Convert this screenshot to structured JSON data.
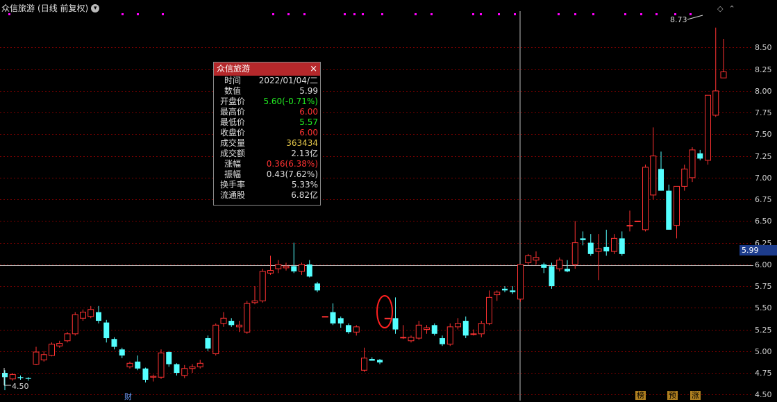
{
  "title": {
    "stock_name": "众信旅游",
    "mode": "(日线 前复权)"
  },
  "colors": {
    "up": "#ff3232",
    "down": "#54ffff",
    "magenta": "#ff00ff",
    "grid": "#7a0000",
    "crosshair": "#c0c0c0"
  },
  "icons": {
    "dropdown": "chevron-down-icon",
    "diamond": "diamond-icon",
    "collapse": "collapse-icon"
  },
  "tooltip": {
    "name": "众信旅游",
    "close_icon": "×",
    "rows": [
      {
        "k": "时间",
        "v": "2022/01/04/二",
        "color": "#dddddd"
      },
      {
        "k": "数值",
        "v": "5.99",
        "color": "#dddddd"
      },
      {
        "k": "开盘价",
        "v": "5.60(-0.71%)",
        "color": "#22ee22"
      },
      {
        "k": "最高价",
        "v": "6.00",
        "color": "#ff3232"
      },
      {
        "k": "最低价",
        "v": "5.57",
        "color": "#22ee22"
      },
      {
        "k": "收盘价",
        "v": "6.00",
        "color": "#ff3232"
      },
      {
        "k": "成交量",
        "v": "363434",
        "color": "#e6c84a"
      },
      {
        "k": "成交额",
        "v": "2.13亿",
        "color": "#dddddd"
      },
      {
        "k": "涨幅",
        "v": "0.36(6.38%)",
        "color": "#ff3232"
      },
      {
        "k": "振幅",
        "v": "0.43(7.62%)",
        "color": "#dddddd"
      },
      {
        "k": "换手率",
        "v": "5.33%",
        "color": "#dddddd"
      },
      {
        "k": "流通股",
        "v": "6.82亿",
        "color": "#dddddd"
      }
    ]
  },
  "current_price_badge": "5.99",
  "high_label": "8.73",
  "low_label": "4.50",
  "markers": [
    {
      "text": "财",
      "kind": "fin"
    },
    {
      "text": "榜",
      "kind": "event"
    },
    {
      "text": "预",
      "kind": "event"
    },
    {
      "text": "涨",
      "kind": "event"
    }
  ],
  "chart_data": {
    "type": "candlestick",
    "yticks": [
      4.5,
      4.75,
      5.0,
      5.25,
      5.5,
      5.75,
      6.0,
      6.25,
      6.5,
      6.75,
      7.0,
      7.25,
      7.5,
      7.75,
      8.0,
      8.25,
      8.5
    ],
    "ytick_labels": [
      "4.50",
      "4.75",
      "5.00",
      "5.25",
      "5.50",
      "5.75",
      "6.00",
      "6.25",
      "6.50",
      "6.75",
      "7.00",
      "7.25",
      "7.50",
      "7.75",
      "8.00",
      "8.25",
      "8.50"
    ],
    "ylim": [
      4.43,
      8.92
    ],
    "current_price": 5.99,
    "candles": [
      [
        4.75,
        4.78,
        4.55,
        4.7
      ],
      [
        4.68,
        4.75,
        4.66,
        4.73
      ],
      [
        4.7,
        4.72,
        4.67,
        4.69
      ],
      [
        4.69,
        4.7,
        4.66,
        4.68
      ],
      [
        4.85,
        5.05,
        4.84,
        4.99
      ],
      [
        4.9,
        5.0,
        4.88,
        4.96
      ],
      [
        4.95,
        5.1,
        4.94,
        5.08
      ],
      [
        5.06,
        5.12,
        5.04,
        5.09
      ],
      [
        5.12,
        5.22,
        5.1,
        5.2
      ],
      [
        5.2,
        5.45,
        5.18,
        5.42
      ],
      [
        5.38,
        5.48,
        5.35,
        5.45
      ],
      [
        5.4,
        5.52,
        5.38,
        5.48
      ],
      [
        5.45,
        5.52,
        5.32,
        5.35
      ],
      [
        5.33,
        5.36,
        5.1,
        5.15
      ],
      [
        5.14,
        5.16,
        5.02,
        5.05
      ],
      [
        5.02,
        5.04,
        4.92,
        4.95
      ],
      [
        4.82,
        4.88,
        4.8,
        4.86
      ],
      [
        4.88,
        4.95,
        4.78,
        4.8
      ],
      [
        4.8,
        4.81,
        4.64,
        4.67
      ],
      [
        4.7,
        4.73,
        4.65,
        4.71
      ],
      [
        4.7,
        5.02,
        4.68,
        4.98
      ],
      [
        4.99,
        5.0,
        4.82,
        4.85
      ],
      [
        4.85,
        4.86,
        4.72,
        4.75
      ],
      [
        4.72,
        4.84,
        4.69,
        4.8
      ],
      [
        4.8,
        4.85,
        4.75,
        4.82
      ],
      [
        4.82,
        4.9,
        4.8,
        4.86
      ],
      [
        5.15,
        5.18,
        5.0,
        5.03
      ],
      [
        4.97,
        5.32,
        4.95,
        5.3
      ],
      [
        5.32,
        5.45,
        5.28,
        5.38
      ],
      [
        5.35,
        5.38,
        5.28,
        5.3
      ],
      [
        5.28,
        5.35,
        5.22,
        5.3
      ],
      [
        5.22,
        5.58,
        5.2,
        5.55
      ],
      [
        5.56,
        5.75,
        5.54,
        5.58
      ],
      [
        5.58,
        5.95,
        5.56,
        5.92
      ],
      [
        5.9,
        6.1,
        5.88,
        5.93
      ],
      [
        5.95,
        6.05,
        5.9,
        6.0
      ],
      [
        5.96,
        6.02,
        5.93,
        5.98
      ],
      [
        5.98,
        6.25,
        5.9,
        5.92
      ],
      [
        5.92,
        6.02,
        5.88,
        6.0
      ],
      [
        6.0,
        6.05,
        5.85,
        5.86
      ],
      [
        5.78,
        5.8,
        5.68,
        5.7
      ],
      [
        5.4,
        5.4,
        5.4,
        5.4
      ],
      [
        5.45,
        5.55,
        5.3,
        5.32
      ],
      [
        5.38,
        5.4,
        5.27,
        5.32
      ],
      [
        5.3,
        5.32,
        5.2,
        5.22
      ],
      [
        5.22,
        5.3,
        5.18,
        5.28
      ],
      [
        4.78,
        5.04,
        4.76,
        4.92
      ],
      [
        4.91,
        4.93,
        4.89,
        4.89
      ],
      [
        4.9,
        4.91,
        4.85,
        4.87
      ],
      [
        5.38,
        5.38,
        5.38,
        5.38
      ],
      [
        5.38,
        5.62,
        5.2,
        5.25
      ],
      [
        5.16,
        5.3,
        5.14,
        5.16
      ],
      [
        5.12,
        5.18,
        5.1,
        5.16
      ],
      [
        5.15,
        5.35,
        5.13,
        5.3
      ],
      [
        5.25,
        5.3,
        5.2,
        5.27
      ],
      [
        5.3,
        5.32,
        5.18,
        5.2
      ],
      [
        5.15,
        5.18,
        5.06,
        5.08
      ],
      [
        5.08,
        5.32,
        5.06,
        5.28
      ],
      [
        5.28,
        5.38,
        5.25,
        5.32
      ],
      [
        5.35,
        5.4,
        5.15,
        5.18
      ],
      [
        5.2,
        5.25,
        5.18,
        5.2
      ],
      [
        5.2,
        5.35,
        5.16,
        5.32
      ],
      [
        5.32,
        5.7,
        5.3,
        5.62
      ],
      [
        5.65,
        5.7,
        5.58,
        5.68
      ],
      [
        5.72,
        5.75,
        5.68,
        5.7
      ],
      [
        5.7,
        5.75,
        5.66,
        5.68
      ],
      [
        5.6,
        6.0,
        5.57,
        6.0
      ],
      [
        6.02,
        6.12,
        6.0,
        6.1
      ],
      [
        6.05,
        6.15,
        6.0,
        6.08
      ],
      [
        6.0,
        6.02,
        5.9,
        5.96
      ],
      [
        5.98,
        6.02,
        5.72,
        5.75
      ],
      [
        5.95,
        6.08,
        5.92,
        6.05
      ],
      [
        5.95,
        6.05,
        5.91,
        5.92
      ],
      [
        6.0,
        6.5,
        5.95,
        6.25
      ],
      [
        6.3,
        6.38,
        6.22,
        6.28
      ],
      [
        6.25,
        6.35,
        6.1,
        6.12
      ],
      [
        6.15,
        6.35,
        5.82,
        6.18
      ],
      [
        6.2,
        6.4,
        6.1,
        6.15
      ],
      [
        6.15,
        6.35,
        6.12,
        6.3
      ],
      [
        6.3,
        6.38,
        6.1,
        6.12
      ],
      [
        6.45,
        6.62,
        6.38,
        6.45
      ],
      [
        6.5,
        6.5,
        6.5,
        6.5
      ],
      [
        6.4,
        7.15,
        6.38,
        7.12
      ],
      [
        6.8,
        7.58,
        6.75,
        7.25
      ],
      [
        7.1,
        7.3,
        6.85,
        6.85
      ],
      [
        6.85,
        6.92,
        6.45,
        6.4
      ],
      [
        6.45,
        6.88,
        6.3,
        6.9
      ],
      [
        6.9,
        7.15,
        6.85,
        7.1
      ],
      [
        7.0,
        7.35,
        6.95,
        7.32
      ],
      [
        7.28,
        7.32,
        7.2,
        7.22
      ],
      [
        7.2,
        7.95,
        7.15,
        7.95
      ],
      [
        7.72,
        8.73,
        7.7,
        8.0
      ],
      [
        8.15,
        8.6,
        8.15,
        8.22
      ]
    ]
  }
}
